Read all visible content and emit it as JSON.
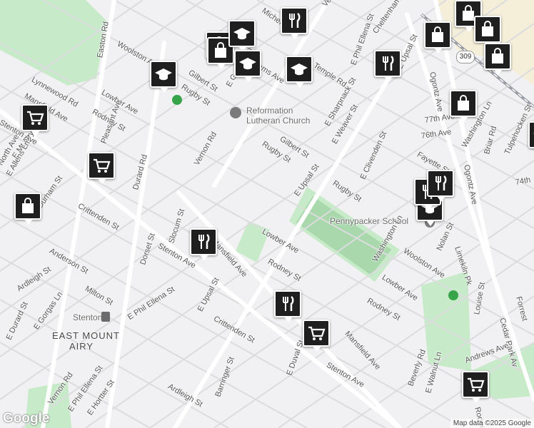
{
  "map": {
    "colors": {
      "road": "#ffffff",
      "minor": "#dcdcdf",
      "park": "#c7ebc9",
      "field": "#a9d8ac",
      "rail": "#9a9ca6",
      "pin": "#1f1f1f"
    },
    "labels": {
      "vernon_rd_top": "Vernon",
      "michener": "Michener",
      "cheltenham": "Cheltenham Ave",
      "phil_ellena_top": "E Phil Ellena St",
      "upsal_top": "E Upsal St",
      "ogontz_top": "Ogontz Ave",
      "easton_rd": "Easton Rd",
      "woolston_top": "Woolston Ave",
      "williams_ave": "Williams Ave",
      "temple_rd": "Temple Rd",
      "gilbert_top": "Gilbert St",
      "rugby_top": "Rugby St",
      "gorgas_top": "E Gorgas Ln",
      "lynnewood": "Lynnewood Rd",
      "mansfield_top": "Mansfield Ave",
      "lowber_top": "Lowber Ave",
      "rodney_top": "Rodney St",
      "pleasant": "Pleasant Ave",
      "mt_airy": "E Mt Airy Ave",
      "north_ave": "North Ave",
      "stenton_top": "Stenton Ave",
      "allens": "E Allens Ln",
      "durham": "Durham St",
      "durard": "Durard Rd",
      "vernon_rd": "Vernon Rd",
      "reformation": "Reformation",
      "lutheran": "Lutheran Church",
      "gilbert_mid": "Gilbert St",
      "rugby_mid": "Rugby St",
      "sharpnack": "E Sharpnack St",
      "weaver": "E Weaver St",
      "upsal_mid": "E Upsal St",
      "rugby_right": "Rugby St",
      "clivenden": "E Clivenden St",
      "fayette": "Fayette St",
      "77th": "77th Ave",
      "76th": "76th Ave",
      "74th": "74th",
      "washington_ln_top": "Washington Ln",
      "tulpehocken": "Tulpehocken St",
      "briar": "Briar Rd",
      "ogontz_mid": "Ogontz Ave",
      "pennypacker": "Pennypacker School",
      "crittenden_left": "Crittenden St",
      "slocum": "Slocum St",
      "dorset": "Dorset St",
      "mansfield_mid": "Mansfield Ave",
      "lowber_mid": "Lowber Ave",
      "stenton_mid": "Stenton Ave",
      "anderson": "Anderson St",
      "rodney_mid": "Rodney St",
      "washington_ln_mid": "Washington Ln",
      "woolston_mid": "Woolston Ave",
      "nolan": "Nolan St",
      "lowber_right": "Lowber Ave",
      "limekiln": "Limekiln Pk",
      "ardleigh_left": "Ardleigh St",
      "milton": "Milton St",
      "phil_ellena_mid": "E Phil Ellena St",
      "upsal_low": "E Upsal St",
      "crittenden_mid": "Crittenden St",
      "rodney_low": "Rodney St",
      "mansfield_low": "Mansfield Ave",
      "louise": "Louise St",
      "forrest": "Forrest",
      "cedar_park": "Cedar Park Av",
      "gorgas_left": "E Gorgas Ln",
      "durard_left": "E Durard St",
      "stenton_station": "Stenton",
      "east_mount": "EAST MOUNT",
      "airy": "AIRY",
      "duval": "E Duval St",
      "stenton_low": "Stenton Ave",
      "beverly": "Beverly Rd",
      "walnut": "E Walnut Ln",
      "andrews": "Andrews Ave",
      "rodney_low_right": "Rodney St",
      "ardleigh_low": "Ardleigh St",
      "barringer": "Barringer St",
      "vernon_low": "Vernon Rd",
      "phil_ellena_low": "E Phil Ellena St",
      "hortter": "E Hortter St",
      "route_309": "309"
    },
    "pins": [
      {
        "kind": "grocery",
        "icon": "cart-icon"
      },
      {
        "kind": "grocery",
        "icon": "cart-icon"
      },
      {
        "kind": "grocery",
        "icon": "cart-icon"
      },
      {
        "kind": "shop",
        "icon": "bag-icon"
      },
      {
        "kind": "shop",
        "icon": "bag-icon"
      },
      {
        "kind": "shop",
        "icon": "bag-icon"
      },
      {
        "kind": "shop",
        "icon": "bag-icon"
      },
      {
        "kind": "shop",
        "icon": "bag-icon"
      },
      {
        "kind": "shop",
        "icon": "bag-icon"
      },
      {
        "kind": "shop",
        "icon": "bag-icon"
      },
      {
        "kind": "shop",
        "icon": "bag-icon"
      },
      {
        "kind": "school",
        "icon": "graduation-cap-icon"
      },
      {
        "kind": "school",
        "icon": "graduation-cap-icon"
      },
      {
        "kind": "school",
        "icon": "graduation-cap-icon"
      },
      {
        "kind": "school",
        "icon": "graduation-cap-icon"
      },
      {
        "kind": "school",
        "icon": "graduation-cap-icon"
      },
      {
        "kind": "school",
        "icon": "graduation-cap-icon"
      },
      {
        "kind": "restaurant",
        "icon": "fork-knife-icon"
      },
      {
        "kind": "restaurant",
        "icon": "fork-knife-icon"
      },
      {
        "kind": "restaurant",
        "icon": "fork-knife-icon"
      },
      {
        "kind": "restaurant",
        "icon": "fork-knife-icon"
      },
      {
        "kind": "restaurant",
        "icon": "fork-knife-icon"
      },
      {
        "kind": "restaurant",
        "icon": "fork-knife-icon"
      },
      {
        "kind": "grocery",
        "icon": "cart-icon"
      }
    ],
    "logo": "Google",
    "attribution": "Map data ©2025 Google"
  }
}
